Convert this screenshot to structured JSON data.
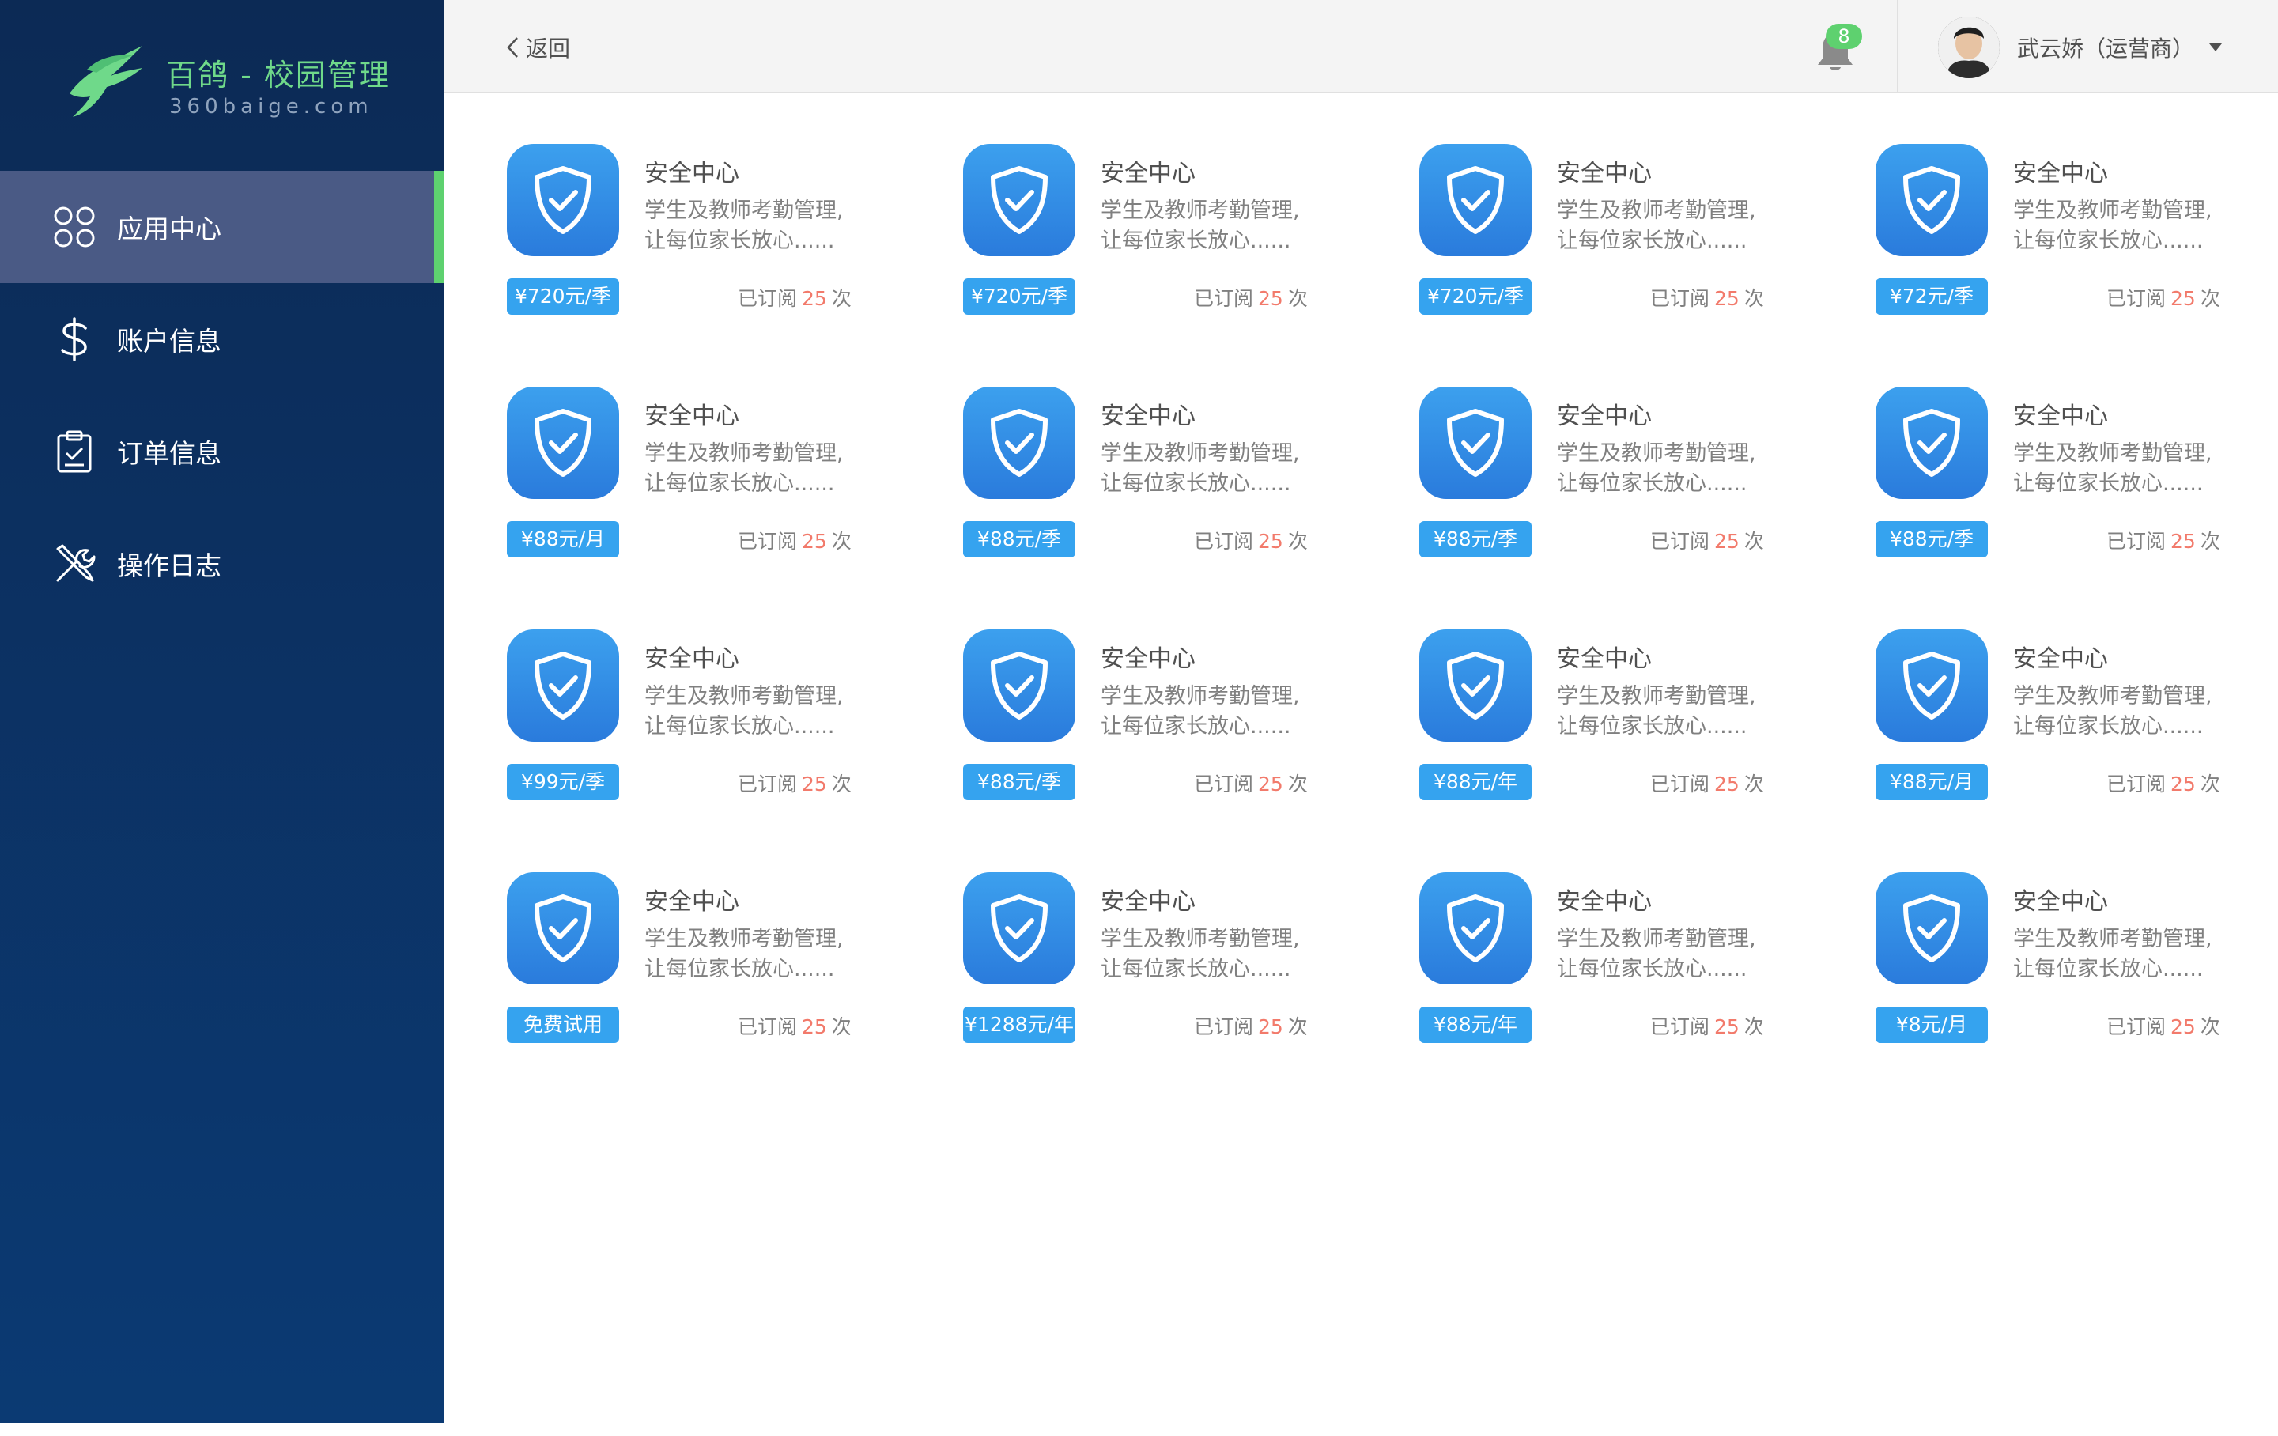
{
  "brand": {
    "title": "百鸽 - 校园管理",
    "subtitle": "360baige.com",
    "accent_color": "#6fd98a"
  },
  "sidebar": {
    "items": [
      {
        "label": "应用中心",
        "icon": "apps-icon",
        "active": true
      },
      {
        "label": "账户信息",
        "icon": "dollar-icon",
        "active": false
      },
      {
        "label": "订单信息",
        "icon": "clipboard-check-icon",
        "active": false
      },
      {
        "label": "操作日志",
        "icon": "tools-icon",
        "active": false
      }
    ]
  },
  "header": {
    "back_label": "返回",
    "notification_count": "8",
    "user_name": "武云娇（运营商）"
  },
  "cards": [
    {
      "title": "安全中心",
      "desc_line1": "学生及教师考勤管理,",
      "desc_line2": "让每位家长放心......",
      "price": "¥720元/季",
      "subs_prefix": "已订阅",
      "subs_count": "25",
      "subs_suffix": "次"
    },
    {
      "title": "安全中心",
      "desc_line1": "学生及教师考勤管理,",
      "desc_line2": "让每位家长放心......",
      "price": "¥720元/季",
      "subs_prefix": "已订阅",
      "subs_count": "25",
      "subs_suffix": "次"
    },
    {
      "title": "安全中心",
      "desc_line1": "学生及教师考勤管理,",
      "desc_line2": "让每位家长放心......",
      "price": "¥720元/季",
      "subs_prefix": "已订阅",
      "subs_count": "25",
      "subs_suffix": "次"
    },
    {
      "title": "安全中心",
      "desc_line1": "学生及教师考勤管理,",
      "desc_line2": "让每位家长放心......",
      "price": "¥72元/季",
      "subs_prefix": "已订阅",
      "subs_count": "25",
      "subs_suffix": "次"
    },
    {
      "title": "安全中心",
      "desc_line1": "学生及教师考勤管理,",
      "desc_line2": "让每位家长放心......",
      "price": "¥88元/月",
      "subs_prefix": "已订阅",
      "subs_count": "25",
      "subs_suffix": "次"
    },
    {
      "title": "安全中心",
      "desc_line1": "学生及教师考勤管理,",
      "desc_line2": "让每位家长放心......",
      "price": "¥88元/季",
      "subs_prefix": "已订阅",
      "subs_count": "25",
      "subs_suffix": "次"
    },
    {
      "title": "安全中心",
      "desc_line1": "学生及教师考勤管理,",
      "desc_line2": "让每位家长放心......",
      "price": "¥88元/季",
      "subs_prefix": "已订阅",
      "subs_count": "25",
      "subs_suffix": "次"
    },
    {
      "title": "安全中心",
      "desc_line1": "学生及教师考勤管理,",
      "desc_line2": "让每位家长放心......",
      "price": "¥88元/季",
      "subs_prefix": "已订阅",
      "subs_count": "25",
      "subs_suffix": "次"
    },
    {
      "title": "安全中心",
      "desc_line1": "学生及教师考勤管理,",
      "desc_line2": "让每位家长放心......",
      "price": "¥99元/季",
      "subs_prefix": "已订阅",
      "subs_count": "25",
      "subs_suffix": "次"
    },
    {
      "title": "安全中心",
      "desc_line1": "学生及教师考勤管理,",
      "desc_line2": "让每位家长放心......",
      "price": "¥88元/季",
      "subs_prefix": "已订阅",
      "subs_count": "25",
      "subs_suffix": "次"
    },
    {
      "title": "安全中心",
      "desc_line1": "学生及教师考勤管理,",
      "desc_line2": "让每位家长放心......",
      "price": "¥88元/年",
      "subs_prefix": "已订阅",
      "subs_count": "25",
      "subs_suffix": "次"
    },
    {
      "title": "安全中心",
      "desc_line1": "学生及教师考勤管理,",
      "desc_line2": "让每位家长放心......",
      "price": "¥88元/月",
      "subs_prefix": "已订阅",
      "subs_count": "25",
      "subs_suffix": "次"
    },
    {
      "title": "安全中心",
      "desc_line1": "学生及教师考勤管理,",
      "desc_line2": "让每位家长放心......",
      "price": "免费试用",
      "subs_prefix": "已订阅",
      "subs_count": "25",
      "subs_suffix": "次"
    },
    {
      "title": "安全中心",
      "desc_line1": "学生及教师考勤管理,",
      "desc_line2": "让每位家长放心......",
      "price": "¥1288元/年",
      "subs_prefix": "已订阅",
      "subs_count": "25",
      "subs_suffix": "次"
    },
    {
      "title": "安全中心",
      "desc_line1": "学生及教师考勤管理,",
      "desc_line2": "让每位家长放心......",
      "price": "¥88元/年",
      "subs_prefix": "已订阅",
      "subs_count": "25",
      "subs_suffix": "次"
    },
    {
      "title": "安全中心",
      "desc_line1": "学生及教师考勤管理,",
      "desc_line2": "让每位家长放心......",
      "price": "¥8元/月",
      "subs_prefix": "已订阅",
      "subs_count": "25",
      "subs_suffix": "次"
    }
  ],
  "colors": {
    "sidebar_bg": "#0c2a55",
    "active_item_bg": "#4a5a85",
    "active_indicator": "#5ed16f",
    "price_tag_bg": "#35a3ef",
    "count_color": "#f27a6b",
    "title_text": "#505050",
    "desc_text": "#808080"
  }
}
